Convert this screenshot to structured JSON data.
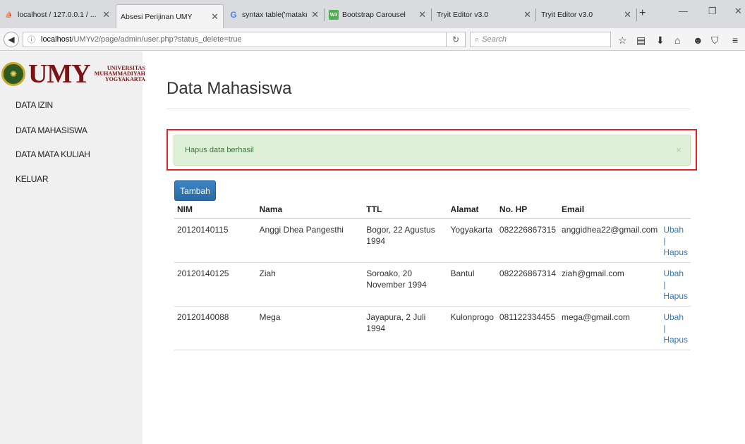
{
  "browser": {
    "tabs": [
      {
        "favicon": "phpmyadmin-icon",
        "title": "localhost / 127.0.0.1 / ...",
        "close": "✕"
      },
      {
        "favicon": "none",
        "title": "Absesi Perijinan UMY",
        "close": "✕"
      },
      {
        "favicon": "google-icon",
        "title": "syntax table('matakuli...",
        "close": "✕"
      },
      {
        "favicon": "w3schools-icon",
        "title": "Bootstrap Carousel",
        "close": "✕"
      },
      {
        "favicon": "none",
        "title": "Tryit Editor v3.0",
        "close": "✕"
      },
      {
        "favicon": "none",
        "title": "Tryit Editor v3.0",
        "close": "✕"
      }
    ],
    "url_host": "localhost",
    "url_path": "/UMYv2/page/admin/user.php?status_delete=true",
    "search_placeholder": "Search"
  },
  "logo": {
    "text": "UMY",
    "sub1": "UNIVERSITAS",
    "sub2": "MUHAMMADIYAH",
    "sub3": "YOGYAKARTA"
  },
  "sidebar": {
    "items": [
      {
        "label": "DATA IZIN"
      },
      {
        "label": "DATA MAHASISWA"
      },
      {
        "label": "DATA MATA KULIAH"
      },
      {
        "label": "KELUAR"
      }
    ]
  },
  "main": {
    "title": "Data Mahasiswa",
    "alert": "Hapus data berhasil",
    "alert_close": "×",
    "add_button": "Tambah",
    "table": {
      "headers": [
        "NIM",
        "Nama",
        "TTL",
        "Alamat",
        "No. HP",
        "Email",
        ""
      ],
      "rows": [
        {
          "nim": "20120140115",
          "nama": "Anggi Dhea Pangesthi",
          "ttl": "Bogor, 22 Agustus 1994",
          "alamat": "Yogyakarta",
          "hp": "082226867315",
          "email": "anggidhea22@gmail.com",
          "ubah": "Ubah |",
          "hapus": "Hapus"
        },
        {
          "nim": "20120140125",
          "nama": "Ziah",
          "ttl": "Soroako, 20 November 1994",
          "alamat": "Bantul",
          "hp": "082226867314",
          "email": "ziah@gmail.com",
          "ubah": "Ubah |",
          "hapus": "Hapus"
        },
        {
          "nim": "20120140088",
          "nama": "Mega",
          "ttl": "Jayapura, 2 Juli 1994",
          "alamat": "Kulonprogo",
          "hp": "081122334455",
          "email": "mega@gmail.com",
          "ubah": "Ubah |",
          "hapus": "Hapus"
        }
      ]
    }
  },
  "colors": {
    "highlight_border": "#e32222",
    "alert_bg": "#dff0d8",
    "primary": "#337ab7",
    "brand": "#7a1416"
  }
}
